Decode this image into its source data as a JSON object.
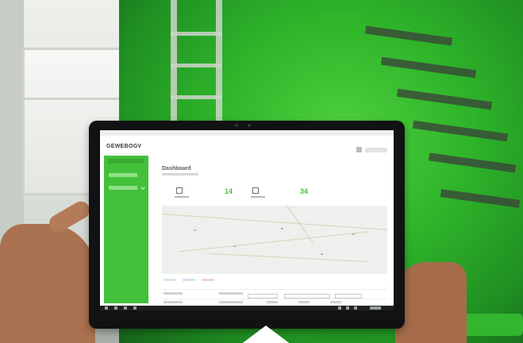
{
  "photo": {
    "subject": "hands holding a tablet in front of green industrial machinery",
    "colors": {
      "machine_green": "#2fb52a",
      "app_accent": "#43c13a",
      "tablet_bezel": "#111213"
    }
  },
  "app": {
    "brand": "GEWEBOGV",
    "page_title": "Dashboard",
    "stats": [
      {
        "icon": "machine-icon",
        "value": ""
      },
      {
        "icon": "",
        "value": "14"
      },
      {
        "icon": "user-icon",
        "value": ""
      },
      {
        "icon": "",
        "value": "34"
      }
    ],
    "map": {
      "kind": "street map"
    },
    "legend_colors": [
      "#4cb944",
      "#3a6cd6",
      "#d84b4b"
    ]
  }
}
